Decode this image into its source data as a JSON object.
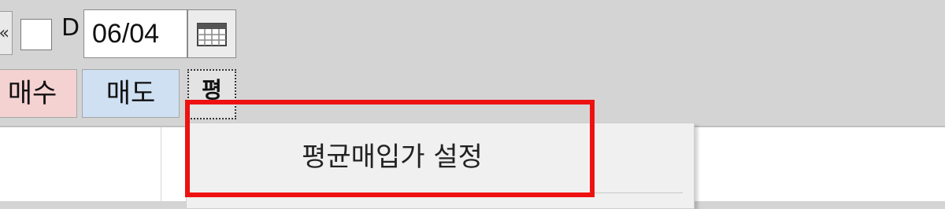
{
  "toolbar": {
    "prev_glyph": "«",
    "d_label": "D",
    "date_value": "06/04",
    "buy_label": "매수",
    "sell_label": "매도",
    "avg_button_label": "평"
  },
  "context_menu": {
    "items": [
      {
        "label": "평균매입가 설정"
      }
    ]
  },
  "colors": {
    "buy_bg": "#f5d2d2",
    "sell_bg": "#cfe0f2",
    "highlight": "#ee1111"
  },
  "icons": {
    "calendar": "calendar-icon"
  }
}
